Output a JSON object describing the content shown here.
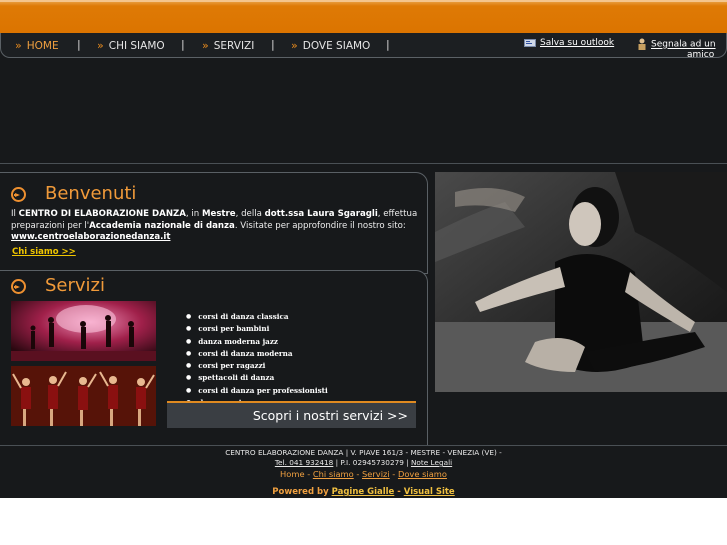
{
  "nav": {
    "items": [
      {
        "label": "HOME",
        "active": true
      },
      {
        "label": "CHI SIAMO",
        "active": false
      },
      {
        "label": "SERVIZI",
        "active": false
      },
      {
        "label": "DOVE SIAMO",
        "active": false
      }
    ],
    "separator": "|",
    "chevron": "»",
    "save_outlook": "Salva su outlook",
    "tell_friend_1": "Segnala ad un",
    "tell_friend_2": "amico"
  },
  "welcome": {
    "title": "Benvenuti",
    "p_il": "Il ",
    "p_name": "CENTRO DI ELABORAZIONE DANZA",
    "p_in": ", in ",
    "p_city": "Mestre",
    "p_of": ", della ",
    "p_doc": "dott.ssa Laura Sgaragli",
    "p_rest1": ", effettua preparazioni per l'",
    "p_academy": "Accademia nazionale di danza",
    "p_rest2": ". Visitate per approfondire il nostro sito: ",
    "p_site": "www.centroelaborazionedanza.it",
    "link": "Chi siamo >>"
  },
  "services": {
    "title": "Servizi",
    "items": [
      "corsi di danza classica",
      "corsi per bambini",
      "danza moderna jazz",
      "corsi di danza moderna",
      "corsi per ragazzi",
      "spettacoli di danza",
      "corsi di danza per professionisti",
      "danza contemporanea"
    ],
    "button": "Scopri i nostri servizi >>"
  },
  "footer": {
    "address": "CENTRO ELABORAZIONE DANZA | V. PIAVE 161/3 - MESTRE - VENEZIA (VE) -",
    "tel": "Tel. 041 932418",
    "piva": " | P.I. 02945730279 | ",
    "legal": "Note Legali",
    "links": [
      "Home",
      "Chi siamo",
      "Servizi",
      "Dove siamo"
    ],
    "link_sep": " - ",
    "powered_prefix": "Powered by ",
    "powered_link1": "Pagine Gialle",
    "powered_sep": " - ",
    "powered_link2": "Visual Site"
  },
  "colors": {
    "accent": "#de7a05",
    "background": "#17191b",
    "title": "#f09a3a",
    "link_yellow": "#f0c600"
  }
}
